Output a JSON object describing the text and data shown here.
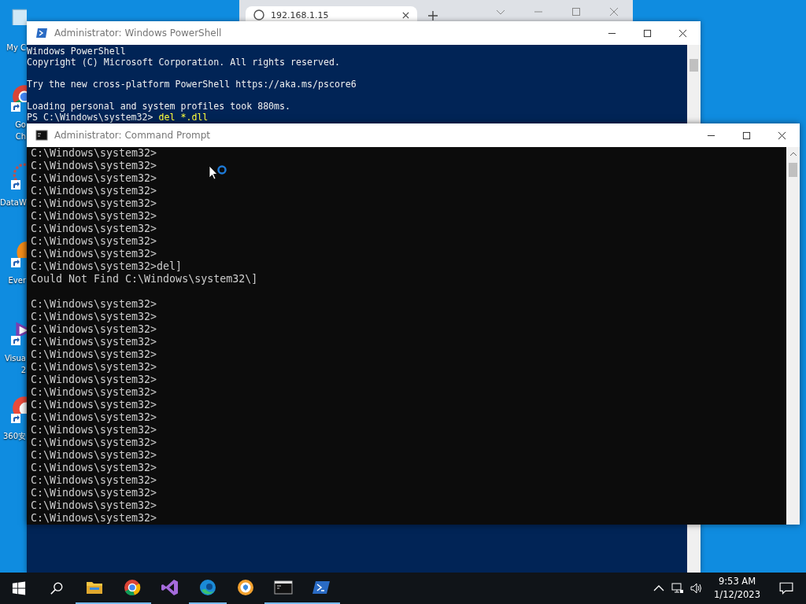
{
  "desktop_icons": [
    {
      "kind": "computer",
      "label": "My C",
      "shortcut": false
    },
    {
      "kind": "chrome",
      "label": "Go\nCh",
      "shortcut": true
    },
    {
      "kind": "network",
      "label": "DataW",
      "shortcut": true
    },
    {
      "kind": "orange",
      "label": "Ever",
      "shortcut": true
    },
    {
      "kind": "visual-studio",
      "label": "Visua\n2",
      "shortcut": true
    },
    {
      "kind": "browser-360",
      "label": "360安",
      "shortcut": true
    }
  ],
  "browser_window": {
    "tab_title": "192.168.1.15"
  },
  "powershell_window": {
    "title": "Administrator: Windows PowerShell",
    "lines": [
      {
        "kind": "text",
        "text": "Windows PowerShell"
      },
      {
        "kind": "text",
        "text": "Copyright (C) Microsoft Corporation. All rights reserved."
      },
      {
        "kind": "blank"
      },
      {
        "kind": "text",
        "text": "Try the new cross-platform PowerShell https://aka.ms/pscore6"
      },
      {
        "kind": "blank"
      },
      {
        "kind": "text",
        "text": "Loading personal and system profiles took 880ms."
      },
      {
        "kind": "command",
        "prompt": "PS C:\\Windows\\system32> ",
        "command": "del *.dll"
      }
    ]
  },
  "cmd_window": {
    "title": "Administrator: Command Prompt",
    "lines": [
      {
        "kind": "text",
        "text": "C:\\Windows\\system32>"
      },
      {
        "kind": "text",
        "text": "C:\\Windows\\system32>"
      },
      {
        "kind": "text",
        "text": "C:\\Windows\\system32>"
      },
      {
        "kind": "text",
        "text": "C:\\Windows\\system32>"
      },
      {
        "kind": "text",
        "text": "C:\\Windows\\system32>"
      },
      {
        "kind": "text",
        "text": "C:\\Windows\\system32>"
      },
      {
        "kind": "text",
        "text": "C:\\Windows\\system32>"
      },
      {
        "kind": "text",
        "text": "C:\\Windows\\system32>"
      },
      {
        "kind": "text",
        "text": "C:\\Windows\\system32>"
      },
      {
        "kind": "text",
        "text": "C:\\Windows\\system32>del]"
      },
      {
        "kind": "text",
        "text": "Could Not Find C:\\Windows\\system32\\]"
      },
      {
        "kind": "blank"
      },
      {
        "kind": "text",
        "text": "C:\\Windows\\system32>"
      },
      {
        "kind": "text",
        "text": "C:\\Windows\\system32>"
      },
      {
        "kind": "text",
        "text": "C:\\Windows\\system32>"
      },
      {
        "kind": "text",
        "text": "C:\\Windows\\system32>"
      },
      {
        "kind": "text",
        "text": "C:\\Windows\\system32>"
      },
      {
        "kind": "text",
        "text": "C:\\Windows\\system32>"
      },
      {
        "kind": "text",
        "text": "C:\\Windows\\system32>"
      },
      {
        "kind": "text",
        "text": "C:\\Windows\\system32>"
      },
      {
        "kind": "text",
        "text": "C:\\Windows\\system32>"
      },
      {
        "kind": "text",
        "text": "C:\\Windows\\system32>"
      },
      {
        "kind": "text",
        "text": "C:\\Windows\\system32>"
      },
      {
        "kind": "text",
        "text": "C:\\Windows\\system32>"
      },
      {
        "kind": "text",
        "text": "C:\\Windows\\system32>"
      },
      {
        "kind": "text",
        "text": "C:\\Windows\\system32>"
      },
      {
        "kind": "text",
        "text": "C:\\Windows\\system32>"
      },
      {
        "kind": "text",
        "text": "C:\\Windows\\system32>"
      },
      {
        "kind": "text",
        "text": "C:\\Windows\\system32>"
      },
      {
        "kind": "text",
        "text": "C:\\Windows\\system32>"
      }
    ]
  },
  "taskbar": {
    "apps": [
      {
        "kind": "explorer",
        "running": true
      },
      {
        "kind": "chrome",
        "running": true
      },
      {
        "kind": "visual-studio",
        "running": false
      },
      {
        "kind": "edge",
        "running": true
      },
      {
        "kind": "browser-360",
        "running": false
      },
      {
        "kind": "cmd",
        "running": true
      },
      {
        "kind": "powershell",
        "running": true
      }
    ],
    "time": "9:53 AM",
    "date": "1/12/2023"
  }
}
